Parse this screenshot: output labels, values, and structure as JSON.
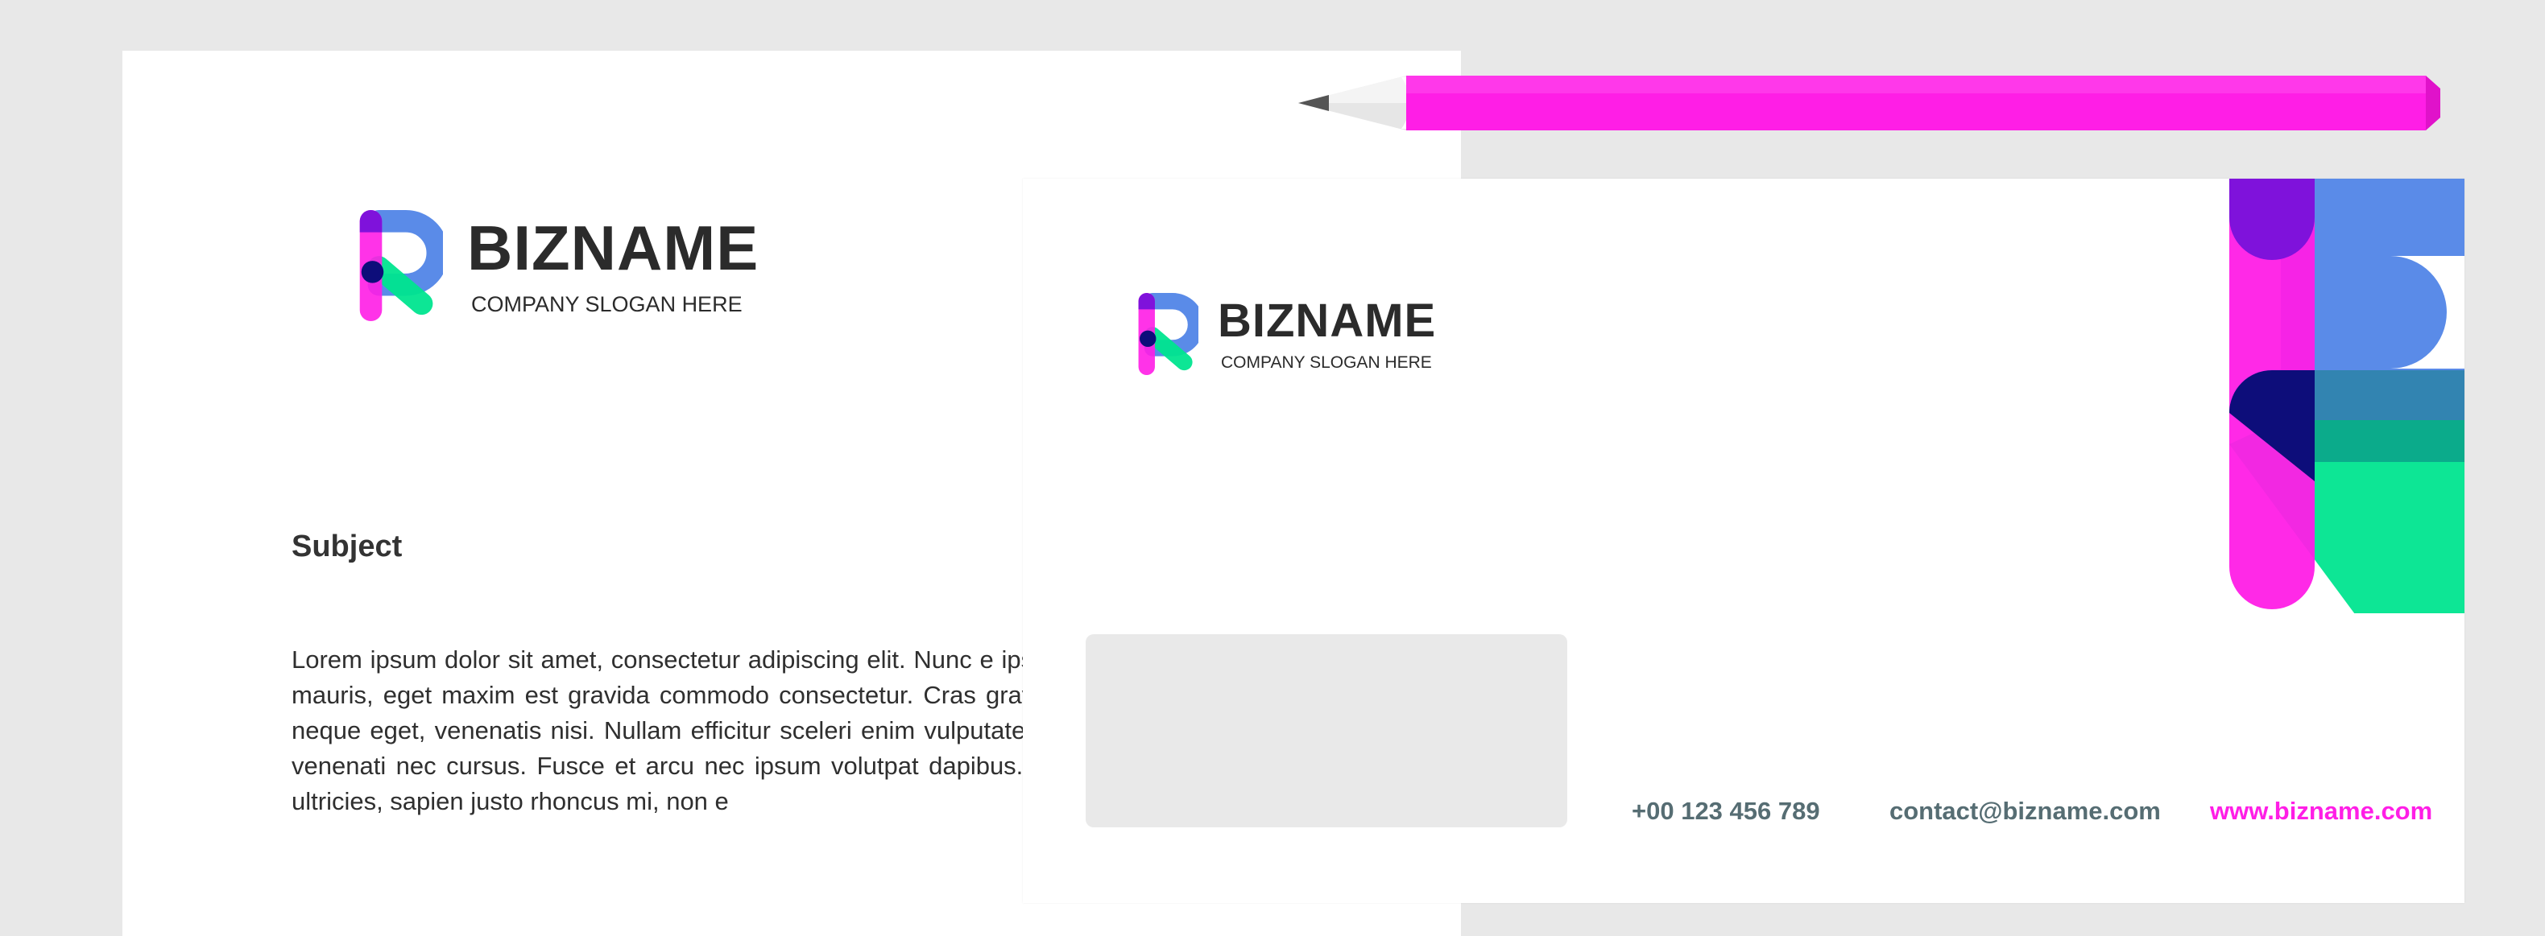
{
  "brand": {
    "name": "BIZNAME",
    "slogan": "COMPANY SLOGAN HERE",
    "colors": {
      "magenta": "#ff1ee6",
      "blue": "#5a8be8",
      "green": "#00e58f",
      "purple": "#7f12db",
      "navy": "#0d0d7a",
      "teal": "#137f84"
    }
  },
  "letterhead": {
    "subject": "Subject",
    "body": "Lorem ipsum dolor sit amet, consectetur adipiscing elit. Nunc e ipsum id, elementum ligula. Mauris in feugiat mauris, eget maxim est gravida commodo consectetur. Cras gravida elit mi, a eleifend ju sagittis, tincidunt neque eget, venenatis nisi. Nullam efficitur sceleri enim vulputate eu. Vestibulum eu tellus eget elit eleifend venenati nec cursus. Fusce et arcu nec ipsum volutpat dapibus. Quisque vulp commodo, nisi nec semper ultricies, sapien justo rhoncus mi, non e"
  },
  "envelope": {
    "phone": "+00 123 456 789",
    "email": "contact@bizname.com",
    "website": "www.bizname.com"
  },
  "icons": [
    "r-logo-icon",
    "pencil-icon",
    "large-r-logo-corner-icon"
  ]
}
